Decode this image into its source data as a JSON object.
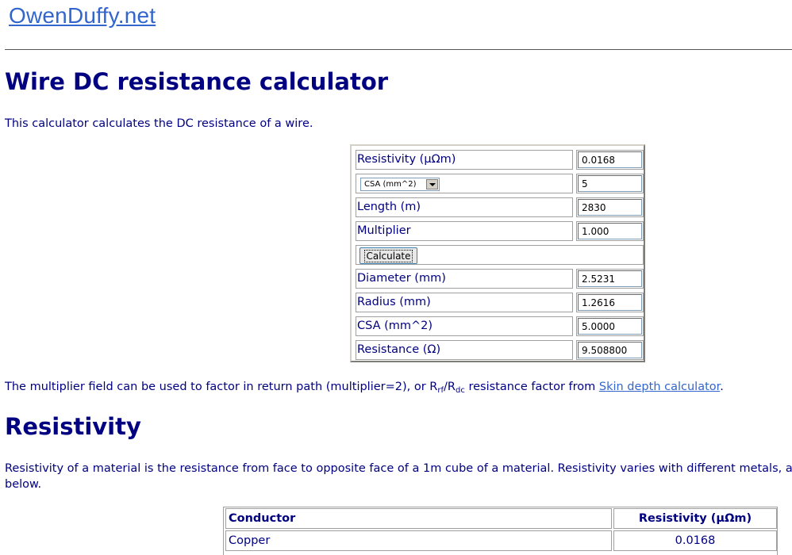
{
  "site": {
    "logo": "OwenDuffy.net"
  },
  "page": {
    "title": "Wire DC resistance calculator",
    "intro": "This calculator calculates the DC resistance of a wire."
  },
  "calculator": {
    "inputs": [
      {
        "label": "Resistivity (μΩm)",
        "value": "0.0168"
      },
      {
        "select_value": "CSA (mm^2)",
        "value": "5"
      },
      {
        "label": "Length (m)",
        "value": "2830"
      },
      {
        "label": "Multiplier",
        "value": "1.000"
      }
    ],
    "calculate_label": "Calculate",
    "outputs": [
      {
        "label": "Diameter (mm)",
        "value": "2.5231"
      },
      {
        "label": "Radius (mm)",
        "value": "1.2616"
      },
      {
        "label": "CSA (mm^2)",
        "value": "5.0000"
      },
      {
        "label": "Resistance (Ω)",
        "value": "9.508800"
      }
    ]
  },
  "multiplier_note": {
    "prefix": "The multiplier field can be used to factor in return path (multiplier=2), or R",
    "sub_rf": "rf",
    "slash": "/R",
    "sub_dc": "dc",
    "middle": " resistance factor from ",
    "link": "Skin depth calculator",
    "suffix": "."
  },
  "resistivity": {
    "title": "Resistivity",
    "desc_line1": "Resistivity of a material is the resistance from face to opposite face of a 1m cube of a material. Resistivity varies with different metals, a",
    "desc_line2": "below.",
    "table": {
      "headers": [
        "Conductor",
        "Resistivity (μΩm)"
      ],
      "rows": [
        [
          "Copper",
          "0.0168"
        ]
      ]
    }
  }
}
